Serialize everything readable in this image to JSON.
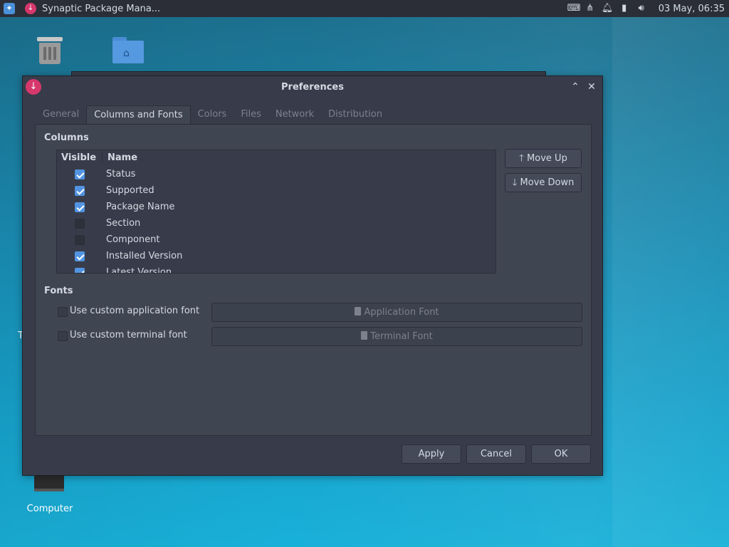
{
  "panel": {
    "task_title": "Synaptic Package Mana...",
    "clock": "03 May, 06:35",
    "tray_icons": [
      "keyboard-icon",
      "network-icon",
      "notification-icon",
      "battery-icon",
      "volume-icon"
    ]
  },
  "desktop": {
    "trash_label_partial": "Trash",
    "partial_label": "T",
    "computer_label": "Computer"
  },
  "dialog": {
    "title": "Preferences",
    "tabs": [
      "General",
      "Columns and Fonts",
      "Colors",
      "Files",
      "Network",
      "Distribution"
    ],
    "active_tab": "Columns and Fonts",
    "columns_section": "Columns",
    "list_headers": {
      "visible": "Visible",
      "name": "Name"
    },
    "columns": [
      {
        "name": "Status",
        "visible": true
      },
      {
        "name": "Supported",
        "visible": true
      },
      {
        "name": "Package Name",
        "visible": true
      },
      {
        "name": "Section",
        "visible": false
      },
      {
        "name": "Component",
        "visible": false
      },
      {
        "name": "Installed Version",
        "visible": true
      },
      {
        "name": "Latest Version",
        "visible": true
      }
    ],
    "move_up": "Move Up",
    "move_down": "Move Down",
    "fonts_section": "Fonts",
    "app_font_check": "Use custom application font",
    "app_font_button": "Application Font",
    "term_font_check": "Use custom terminal font",
    "term_font_button": "Terminal Font",
    "apply": "Apply",
    "cancel": "Cancel",
    "ok": "OK"
  },
  "colors": {
    "accent": "#5294e2",
    "app_icon": "#d6386c",
    "dialog_bg": "#383c4a"
  }
}
